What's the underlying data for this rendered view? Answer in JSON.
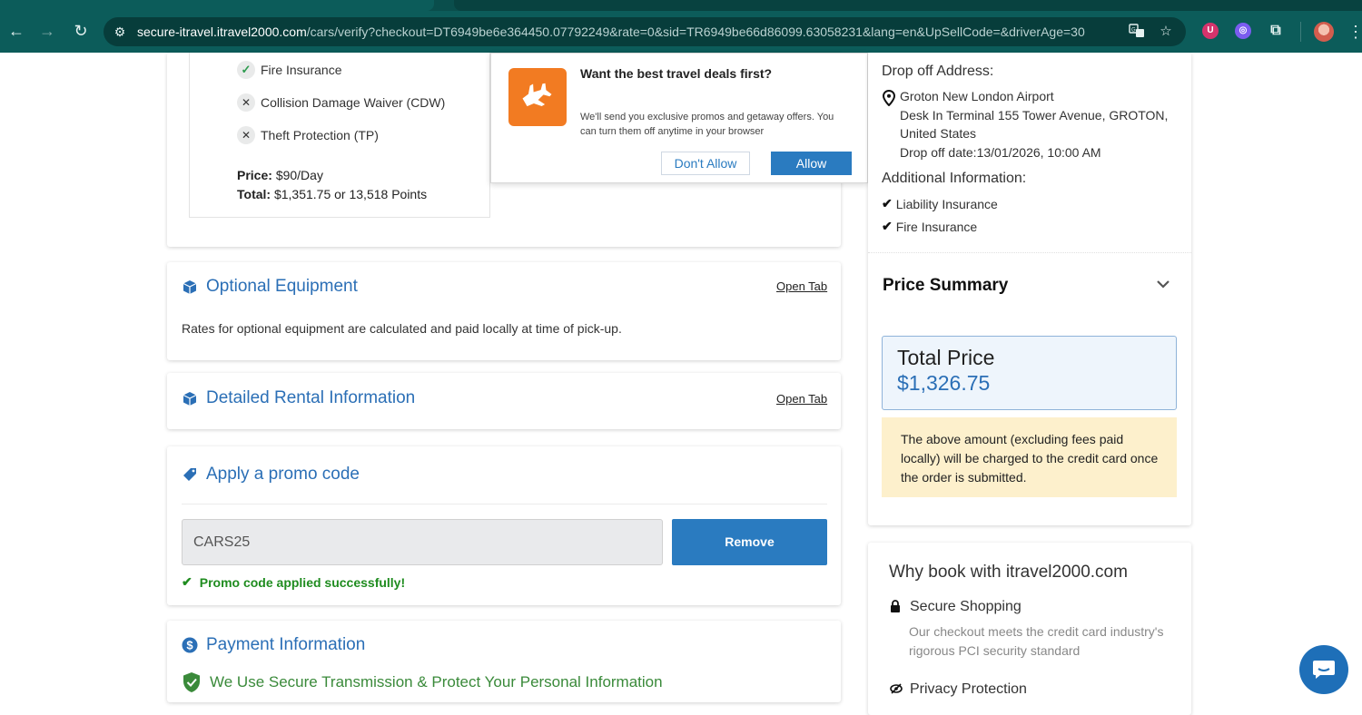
{
  "browser": {
    "url_host": "secure-itravel.itravel2000.com",
    "url_path": "/cars/verify?checkout=DT6949be6e364450.07792249&rate=0&sid=TR6949be66d86099.63058231&lang=en&UpSellCode=&driverAge=30"
  },
  "coverage": {
    "items": [
      {
        "label": "Fire Insurance",
        "included": true
      },
      {
        "label": "Collision Damage Waiver (CDW)",
        "included": false
      },
      {
        "label": "Theft Protection (TP)",
        "included": false
      }
    ],
    "price_label": "Price:",
    "price_value": "$90/Day",
    "total_label": "Total:",
    "total_value": "$1,351.75 or 13,518 Points"
  },
  "optional_equipment": {
    "title": "Optional Equipment",
    "open_tab": "Open Tab",
    "text": "Rates for optional equipment are calculated and paid locally at time of pick-up."
  },
  "detailed_rental": {
    "title": "Detailed Rental Information",
    "open_tab": "Open Tab"
  },
  "promo": {
    "title": "Apply a promo code",
    "value": "CARS25",
    "button": "Remove",
    "success": "Promo code applied successfully!"
  },
  "payment": {
    "title": "Payment Information",
    "secure": "We Use Secure Transmission & Protect Your Personal Information"
  },
  "notification_popup": {
    "heading": "Want the best travel deals first?",
    "text": "We'll send you exclusive promos and getaway offers. You can turn them off anytime in your browser",
    "deny": "Don't Allow",
    "allow": "Allow"
  },
  "sidebar": {
    "dropoff_label": "Drop off Address:",
    "dropoff_line1": "Groton New London Airport",
    "dropoff_line2": "Desk In Terminal 155 Tower Avenue, GROTON, United States",
    "dropoff_date": "Drop off date:13/01/2026, 10:00 AM",
    "additional_label": "Additional Information:",
    "additional_items": [
      "Liability Insurance",
      "Fire Insurance"
    ],
    "price_summary": "Price Summary",
    "total_label": "Total Price",
    "total_value": "$1,326.75",
    "notice": "The above amount (excluding fees paid locally) will be charged to the credit card once the order is submitted."
  },
  "why_book": {
    "title": "Why book with itravel2000.com",
    "item1": "Secure Shopping",
    "item1_text": "Our checkout meets the credit card industry's rigorous PCI security standard",
    "item2": "Privacy Protection"
  },
  "colors": {
    "brand_blue": "#2b6fb6",
    "button_blue": "#2a7bc0",
    "success_green": "#1f8c1f",
    "notice_bg": "#fdf0cc",
    "browser_teal": "#0c5c5a"
  }
}
